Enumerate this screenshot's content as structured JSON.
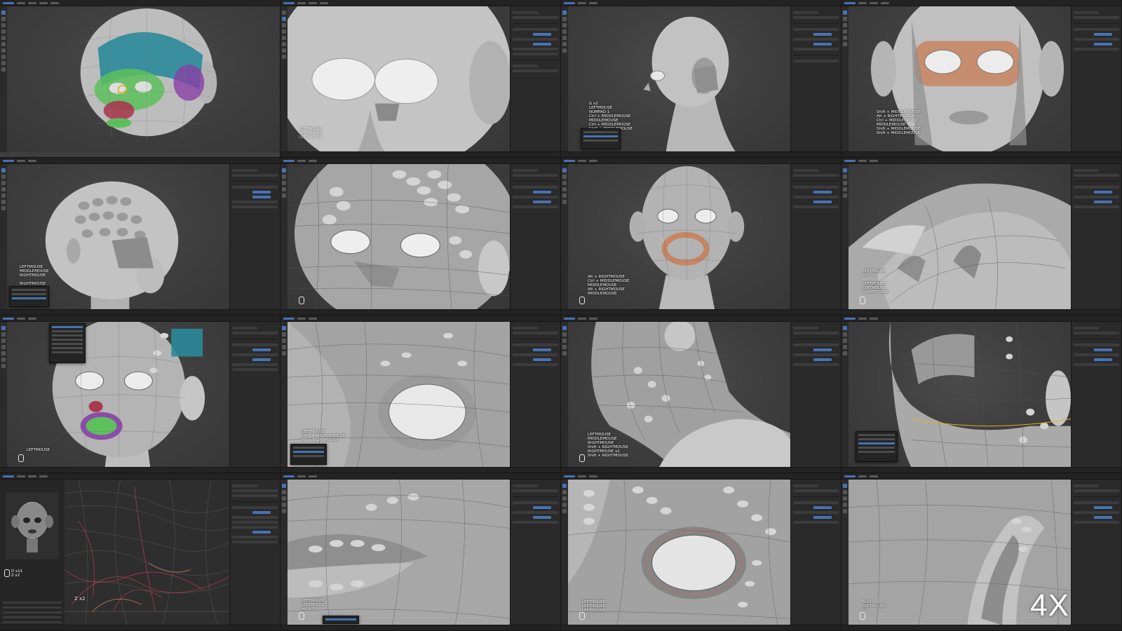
{
  "overlay": {
    "speed_badge": "4X"
  },
  "colors": {
    "ui_bg": "#3f3f3f",
    "panel": "#2a2a2a",
    "accent_blue": "#4772b3",
    "skin": "#c8c8c8",
    "paint_teal": "#2a8a9a",
    "paint_green": "#5cc15c",
    "paint_purple": "#8a3fa8",
    "paint_orange": "#c8805a",
    "paint_red": "#a83a50"
  },
  "tiles": [
    {
      "id": "r1c1",
      "scene": "head-painted-masks",
      "keys": []
    },
    {
      "id": "r1c2",
      "scene": "face-closeup-eyes",
      "keys": []
    },
    {
      "id": "r1c3",
      "scene": "head-side-view",
      "keys": []
    },
    {
      "id": "r1c4",
      "scene": "face-orange-eye-loop",
      "keys": []
    },
    {
      "id": "r2c1",
      "scene": "head-back-dots",
      "keys": [
        "LEFTMOUSE",
        "MIDDLEMOUSE",
        "RIGHTMOUSE",
        "",
        "RIGHTMOUSE"
      ]
    },
    {
      "id": "r2c2",
      "scene": "face-dots-closeup",
      "keys": []
    },
    {
      "id": "r2c3",
      "scene": "head-front-mouth-loop",
      "keys": [
        "Alt + RIGHTMOUSE",
        "Ctrl + MIDDLEMOUSE",
        "MIDDLEMOUSE",
        "Alt + RIGHTMOUSE",
        "MIDDLEMOUSE"
      ]
    },
    {
      "id": "r2c4",
      "scene": "nose-closeup",
      "keys": [
        "LEFTMOUSE",
        "Ctrl + R",
        "",
        "LEFTMOUSE",
        "LEFTMOUSE",
        "RIGHTMOUSE"
      ]
    },
    {
      "id": "r3c1",
      "scene": "face-green-mouth-menu",
      "keys": [
        "LEFTMOUSE"
      ]
    },
    {
      "id": "r3c2",
      "scene": "eye-socket-topology",
      "keys": []
    },
    {
      "id": "r3c3",
      "scene": "neck-profile",
      "keys": [
        "LEFTMOUSE",
        "MIDDLEMOUSE",
        "RIGHTMOUSE",
        "Shift + RIGHTMOUSE",
        "RIGHTMOUSE x2",
        "Shift + RIGHTMOUSE"
      ]
    },
    {
      "id": "r3c4",
      "scene": "jaw-underside",
      "keys": []
    },
    {
      "id": "r4c1",
      "scene": "uv-curves-editor",
      "keys": [
        "D x11",
        "Z x2"
      ],
      "graph_label": "Z x2"
    },
    {
      "id": "r4c2",
      "scene": "lips-closeup",
      "keys": [
        "LEFTMOUSE",
        "LEFTMOUSE",
        "Alt + X"
      ]
    },
    {
      "id": "r4c3",
      "scene": "eye-hole-dots",
      "keys": [
        "LEFTMOUSE",
        "LEFTMOUSE",
        "LEFTMOUSE"
      ]
    },
    {
      "id": "r4c4",
      "scene": "ear-closeup",
      "keys": [
        "B x2",
        "LEFTMOUSE",
        "G"
      ]
    }
  ]
}
